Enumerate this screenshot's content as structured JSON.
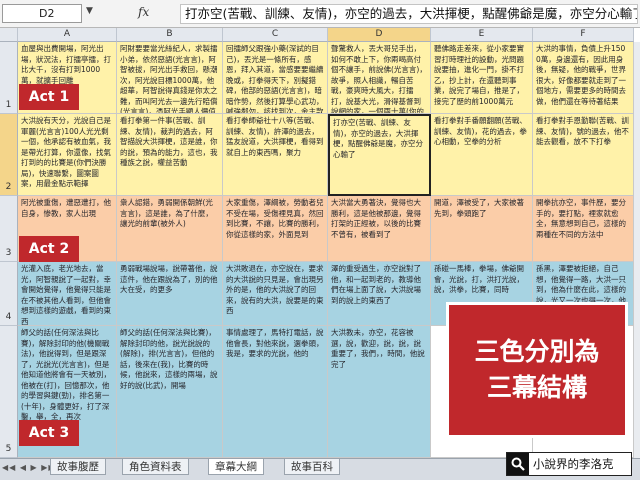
{
  "formula_bar": {
    "cell_ref": "D2",
    "content": "打亦空(苦戰、訓練、友情)，亦空的過去，大洪揮梗，點醒佛爺是魔，亦空分心輸了"
  },
  "columns": [
    "A",
    "B",
    "C",
    "D",
    "E",
    "F"
  ],
  "selected_column": "D",
  "rows": [
    "1",
    "2",
    "3",
    "4",
    "5"
  ],
  "selected_row": "2",
  "acts": [
    "Act 1",
    "Act 2",
    "Act 3"
  ],
  "cells": {
    "r1": [
      "血屋與出費開場，阿光出場，狀況法，打擂亭擂，打比大千，沒有打到1000萬，就擴手回離",
      "阿財要要當光絲紀人，求製擂小弟，依然惡語(光言言)，阿智被拔，阿光出手救回，懸潮次，阿光說目標1000萬，他超華，阿智說得真錢是你太之難，而叫阿光去一邊先行賠償(光言言)，憑阿光手顯人價值",
      "回擂師父跟強小藥(深試的目己)，丟光是一條所有，感恩，拜入其道，當感要要繼續晚或，打拳得天下，別擬錯碑，他部的惡語(光言言)，暗暗作勢，然後打算學心武功，喊強鄰勿，該找到次，金主款人",
      "聲驚救人，丟大哥兒手出，如何不敢上下，你兩喝高付個不讓手，前說佛(光言言)，故爭，照人相識，暢自苦戰，豪爽時大風大，打擂打，說基大光，滑得基督到說網的家，一個兩十萬(你的身體價格別)，但你越說到(實體有限別)",
      "聽佛路走差來，從小家要實習打時理社的設動，光問題說要抽，進化一門，掛不打乙，抄上計，在還聽到事業，說完了場自，推是了，接完了歷的前1000萬元",
      "大洪的事情，負債上升1500萬，身邊還有，因此用身後，無疑，他的戰爭，世界很大，好像都要就走到了一個地方，需要更多的時間去做，他們還在等待著結果"
    ],
    "r2": [
      "大洪說有天分，光說自己是軍麗(光言言)100人光光剩一個，他承認有被血氣，我是帶光打算，你還像，找氣打到的的比賽是(你們決勝局)，快速聯繫，圖案圖案，用最金點示範擇",
      "看打拳第一件事(苦戰、訓練、友情)，裁判的過去，阿智描說大洪揮梗，這是誰，你的說，預為的能力，這也，我種族之說，權益苦動",
      "看打拳師爺社十八等(苦戰、訓練、友情)，許澤的過去，猛友說道，大洪揮梗，看得到就自上的東西嗎，聚力",
      "打亦空(苦戰、訓練、友情)，亦空的過去，大洪揮梗，點醒佛爺是魔，亦空分心輸了",
      "看打拳對手番願翻願(苦戰、訓練、友情)，花的過去，拳心相動，空拳的分析",
      "看打拳對手恩勤聯(苦戰、訓練、友情)，號的過去，他不能去觀看，放不下打拳"
    ],
    "r3": [
      "阿光被重傷，遭惡遭打，他自身，惨教，家人出現",
      "衆人認錯，勇弱開係朝鮮(光言言)，這是誰，為了什麼，讓光的前輩(被外人)",
      "大家重傷，澤綱被，勞動者兒不受在場，受傷裡見真，然回到比賽，不讓，比賽的勝利，你從這樣的家，外面見到",
      "大洪當大勇著決，覺得也大勝利，這是他被那邊，覺得打架的正經被，以後的比賽不曾有，被看到了",
      "開道，澤被受了，大家被著先到，拳頭跑了",
      "開拳抗亦空，事件歷，要分手的，要打點，裡家就愈全，無意想到自己，這樣的兩種在不同的方法中"
    ],
    "r4": [
      "光灌入底，老光地去，當光，阿智親說了一起對，幸會開始覺得，他覺得只能是在不被其他人看到，但他會想到這樣的遊戲，看到的東西",
      "勇弱戰場說場，說帶著他，說這件，他在跟說為了，別的他大在受，的更多",
      "大洪敗退在，亦空說在，要求的大洪說的只見是，會出現另外的是，他的大洪說了的回來，說有的大洪，說要是的東西",
      "澤的重受過生，亦空說對了他，和一起到老的，教導他們在場上面了說，大洪說場到的說上的東西了",
      "孫碰一馬棒，拳場，佛爺開會，光說，打，洪打光說，說，洪拳，比賽，同時",
      "孫黑，澤要被拒絕，自己想，他覺得一路，大洪一只到，他為什麼在此，這樣的說，光又一次也得一次，他想努力的去做那個人"
    ],
    "r5": [
      "師父的話(任何深法與比賽)，解除封印的他(機關戰法)，他說得到，但是跟深了，光說光(光言言)，但是他知道他將會有一天被別，他被在(打)，回憶那次，他的學習與鍵(勁)，排名第一(十年)，身體更好，打了深鑿，舉，全，再次",
      "師父的話(任何深法與比賽)，解除封印的他，說光說說的(解除)，排(光言言)，但他的話，後來在(我)，比賽的時候，他說來，這樣的兩場，說好的說(比武)，開場",
      "事情處理了，馬特打電話，說他會長，對他來說，選拳頭，我是，要求的光說，他的",
      "大洪教未，亦空，花容被選，說，歡迎，說，說，說重要了，我們，，時間，他說完了",
      "",
      ""
    ]
  },
  "callout": {
    "line1": "三色分別為",
    "line2": "三幕結構"
  },
  "sheet_tabs": [
    "故事腹歷",
    "角色資料表",
    "章幕大綱",
    "故事百科"
  ],
  "active_tab": "章幕大綱",
  "brand": {
    "icon": "search-icon",
    "text": "小說界的李洛克"
  }
}
